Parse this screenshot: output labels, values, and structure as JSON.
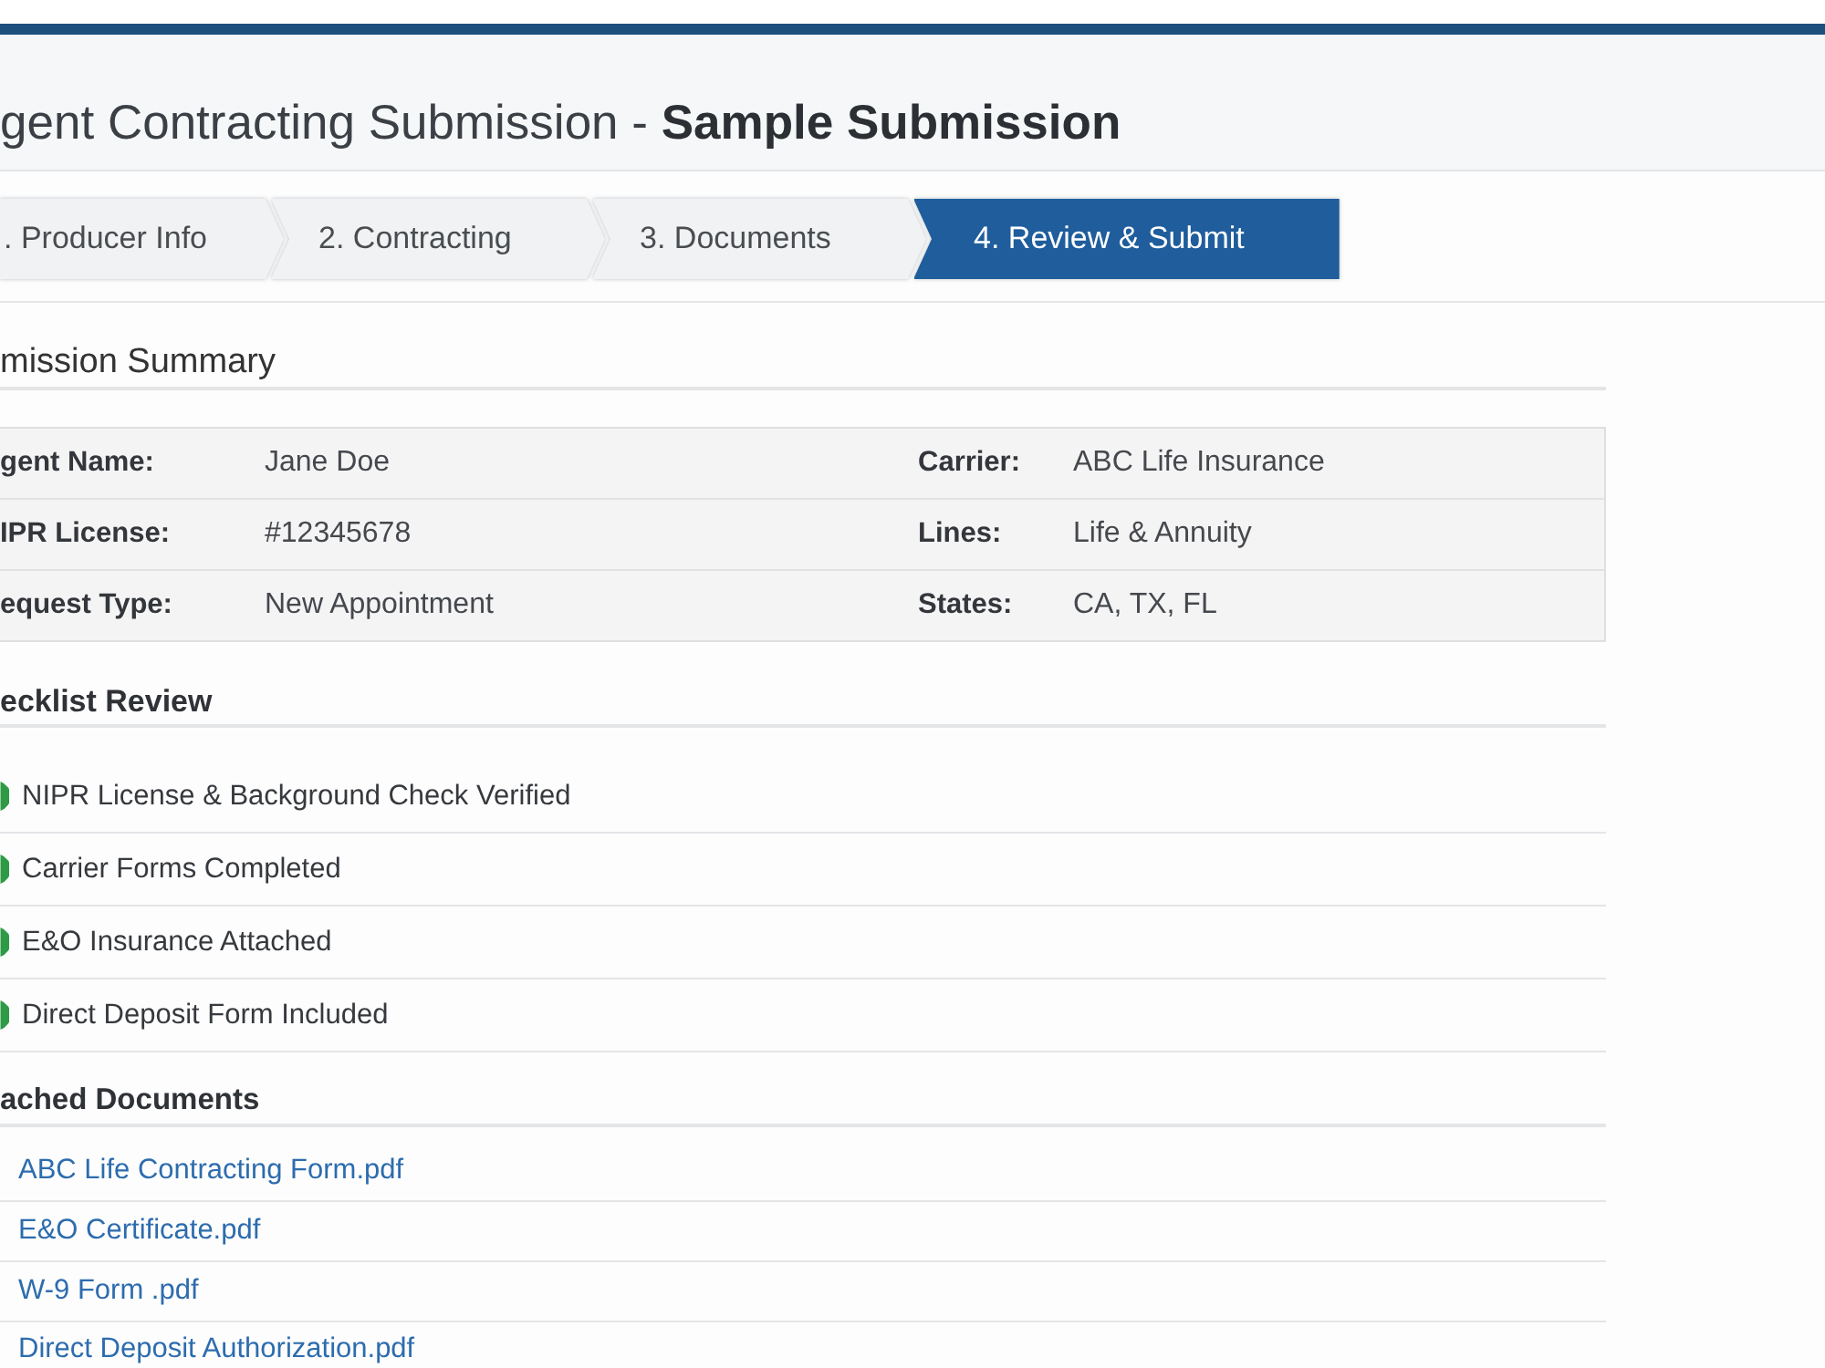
{
  "header": {
    "title": "gent Contracting Submission - **Sample Submission**"
  },
  "steps": [
    {
      "label": ". Producer Info",
      "selected": false
    },
    {
      "label": "2. Contracting",
      "selected": false
    },
    {
      "label": "3. Documents",
      "selected": false
    },
    {
      "label": "4. Review & Submit",
      "selected": true
    }
  ],
  "summary": {
    "heading": "mission Summary",
    "fields": [
      {
        "label": "gent Name:",
        "value": "Jane Doe"
      },
      {
        "label": "Carrier:",
        "value": "ABC Life Insurance"
      },
      {
        "label": "IPR License:",
        "value": "#12345678"
      },
      {
        "label": "Lines:",
        "value": "Life & Annuity"
      },
      {
        "label": "equest Type:",
        "value": "New Appointment"
      },
      {
        "label": "States:",
        "value": "CA, TX, FL"
      }
    ]
  },
  "checklist": {
    "heading": "ecklist Review",
    "items": [
      {
        "label": "NIPR License & Background Check Verified",
        "checked": true
      },
      {
        "label": "Carrier Forms Completed",
        "checked": true
      },
      {
        "label": "E&O Insurance Attached",
        "checked": true
      },
      {
        "label": "Direct Deposit Form Included",
        "checked": true
      }
    ]
  },
  "documents": {
    "heading": "ached Documents",
    "files": [
      "ABC Life Contracting Form.pdf",
      "E&O Certificate.pdf",
      "W-9 Form .pdf",
      "Direct Deposit Authorization.pdf"
    ]
  }
}
